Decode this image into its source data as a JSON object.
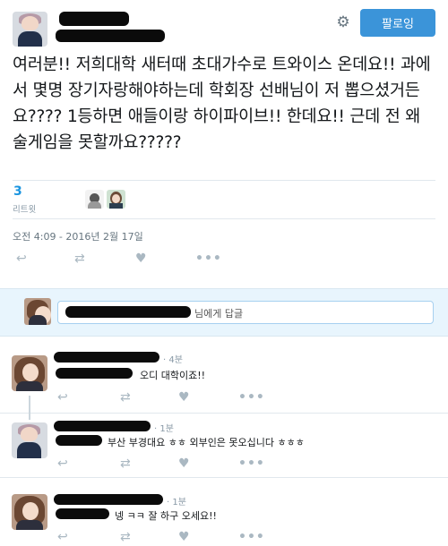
{
  "header": {
    "follow_label": "팔로잉",
    "settings_icon": "gear-icon"
  },
  "tweet": {
    "text": "여러분!!  저희대학 새터때 초대가수로 트와이스 온데요!!  과에서 몇명 장기자랑해야하는데 학회장 선배님이 저 뽑으셨거든요???? 1등하면 애들이랑 하이파이브!!  한데요!!  근데 전 왜 술게임을 못할까요?????",
    "retweet_count": "3",
    "retweet_label": "리트윗",
    "timestamp": "오전 4:09 - 2016년 2월 17일"
  },
  "actions": {
    "reply_icon": "reply-icon",
    "retweet_icon": "retweet-icon",
    "like_icon": "heart-icon",
    "more_icon": "more-icon",
    "more_glyph": "•••"
  },
  "reply_box": {
    "placeholder_suffix": "님에게 답글"
  },
  "replies": [
    {
      "time": "· 4분",
      "text": "오디 대학이죠!!"
    },
    {
      "time": "· 1분",
      "text": "부산 부경대요 ㅎㅎ 외부인은 못오십니다 ㅎㅎㅎ"
    },
    {
      "time": "· 1분",
      "text": "넹 ㅋㅋ 잘 하구 오세요!!"
    }
  ],
  "colors": {
    "accent": "#3b94d9",
    "link": "#1b95e0",
    "reply_box_bg": "#e8f5fd"
  }
}
